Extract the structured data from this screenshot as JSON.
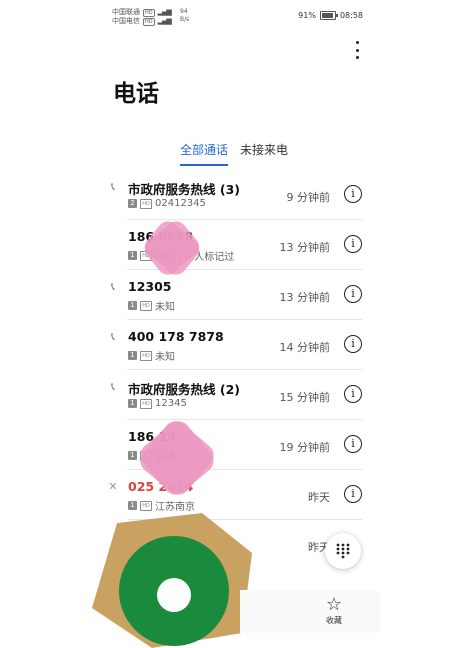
{
  "status_bar": {
    "carrier1": "中国联通",
    "carrier2": "中国电信",
    "hd": "HD",
    "network_speed": "94",
    "speed_unit": "B/s",
    "battery": "91%",
    "time": "08:58"
  },
  "header": {
    "title": "电话"
  },
  "tabs": [
    {
      "label": "全部通话",
      "active": true
    },
    {
      "label": "未接来电",
      "active": false
    }
  ],
  "calls": [
    {
      "name": "市政府服务热线 (3)",
      "sim": "2",
      "detail": "02412345",
      "time": "9 分钟前",
      "missed": false,
      "icon": "outgoing-call-icon"
    },
    {
      "name": "186 0668",
      "sim": "1",
      "detail": "骚扰 | 6 人标记过",
      "time": "13 分钟前",
      "missed": false,
      "icon": ""
    },
    {
      "name": "12305",
      "sim": "1",
      "detail": "未知",
      "time": "13 分钟前",
      "missed": false,
      "icon": "outgoing-call-icon"
    },
    {
      "name": "400 178 7878",
      "sim": "1",
      "detail": "未知",
      "time": "14 分钟前",
      "missed": false,
      "icon": "outgoing-call-icon"
    },
    {
      "name": "市政府服务热线 (2)",
      "sim": "1",
      "detail": "12345",
      "time": "15 分钟前",
      "missed": false,
      "icon": "outgoing-call-icon"
    },
    {
      "name": "186 19",
      "sim": "1",
      "detail": "联通",
      "time": "19 分钟前",
      "missed": false,
      "icon": ""
    },
    {
      "name": "025 2014",
      "sim": "1",
      "detail": "江苏南京",
      "time": "昨天",
      "missed": true,
      "icon": "missed-call-icon"
    },
    {
      "name": "",
      "sim": "",
      "detail": "",
      "time": "昨天",
      "missed": false,
      "icon": ""
    }
  ],
  "bottom_nav": {
    "favorites_label": "收藏"
  },
  "colors": {
    "accent": "#1f6bd6",
    "missed": "#d9453c"
  }
}
